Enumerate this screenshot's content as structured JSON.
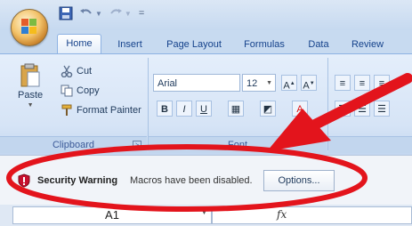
{
  "qat": {
    "separator": "="
  },
  "tabs": [
    "Home",
    "Insert",
    "Page Layout",
    "Formulas",
    "Data",
    "Review"
  ],
  "clipboard": {
    "paste_label": "Paste",
    "cut_label": "Cut",
    "copy_label": "Copy",
    "format_painter_label": "Format Painter",
    "group_label": "Clipboard"
  },
  "font": {
    "name": "Arial",
    "size": "12",
    "group_label": "Font",
    "bold": "B",
    "italic": "I",
    "underline": "U"
  },
  "security": {
    "title": "Security Warning",
    "message": "Macros have been disabled.",
    "options_label": "Options..."
  },
  "formula_bar": {
    "name_box": "A1",
    "fx": "fx"
  },
  "colors": {
    "annotation": "#e3141c",
    "tab_text": "#15428b"
  },
  "icons": [
    "office-button-icon",
    "save-icon",
    "undo-icon",
    "redo-icon",
    "cut-icon",
    "copy-icon",
    "format-painter-icon",
    "paste-icon",
    "shield-warning-icon",
    "dialog-launcher-icon",
    "chevron-down-icon"
  ]
}
